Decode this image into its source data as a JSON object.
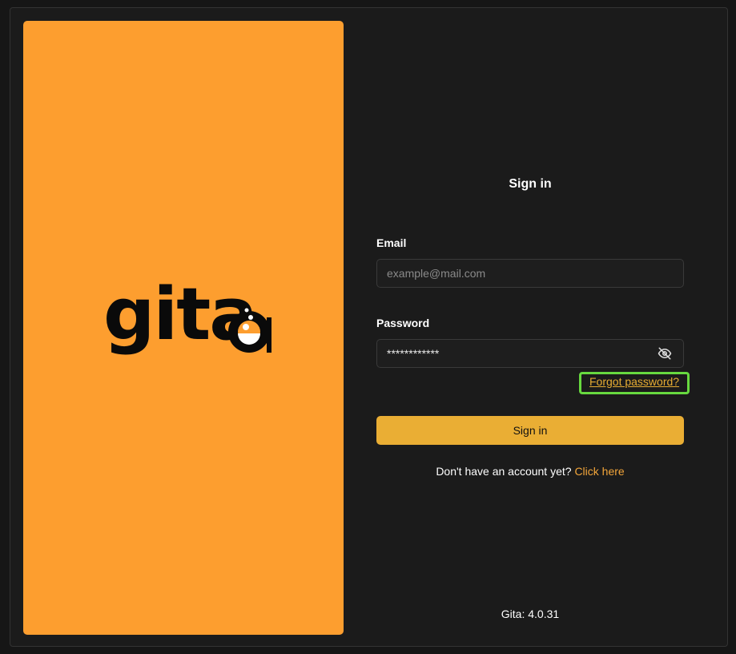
{
  "brand": {
    "logo_text": "gita",
    "panel_color": "#fd9e2f"
  },
  "form": {
    "title": "Sign in",
    "email": {
      "label": "Email",
      "placeholder": "example@mail.com",
      "value": ""
    },
    "password": {
      "label": "Password",
      "value": "************",
      "toggle_icon": "eye-off-icon"
    },
    "forgot_password": "Forgot password?",
    "submit_label": "Sign in",
    "signup_prompt": "Don't have an account yet?",
    "signup_link": "Click here",
    "accent_color": "#eaae34",
    "highlight_color": "#67d93f"
  },
  "footer": {
    "version": "Gita: 4.0.31"
  }
}
